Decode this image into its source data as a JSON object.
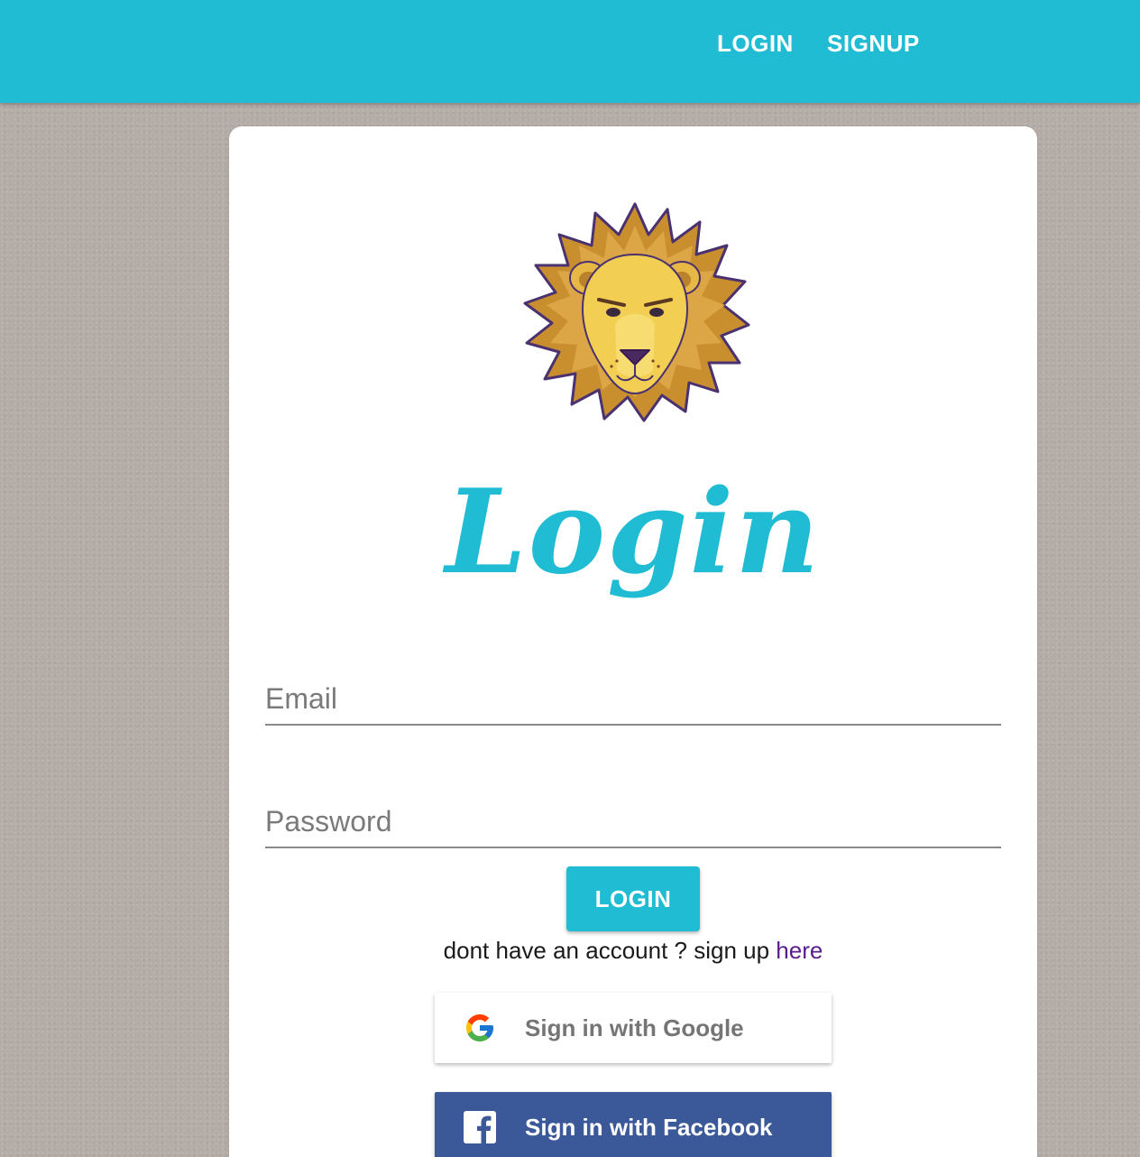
{
  "nav": {
    "login_label": "LOGIN",
    "signup_label": "SIGNUP"
  },
  "card": {
    "title": "Login",
    "logo_icon": "lion-logo-icon",
    "email_placeholder": "Email",
    "password_placeholder": "Password",
    "login_button": "LOGIN",
    "signup_prompt": "dont have an account ? sign up",
    "signup_link": "here",
    "google_button": "Sign in with Google",
    "facebook_button": "Sign in with Facebook"
  },
  "colors": {
    "primary": "#1fbcd3",
    "facebook": "#3b5998",
    "link": "#5a1e8c",
    "background": "#b4aca7"
  }
}
